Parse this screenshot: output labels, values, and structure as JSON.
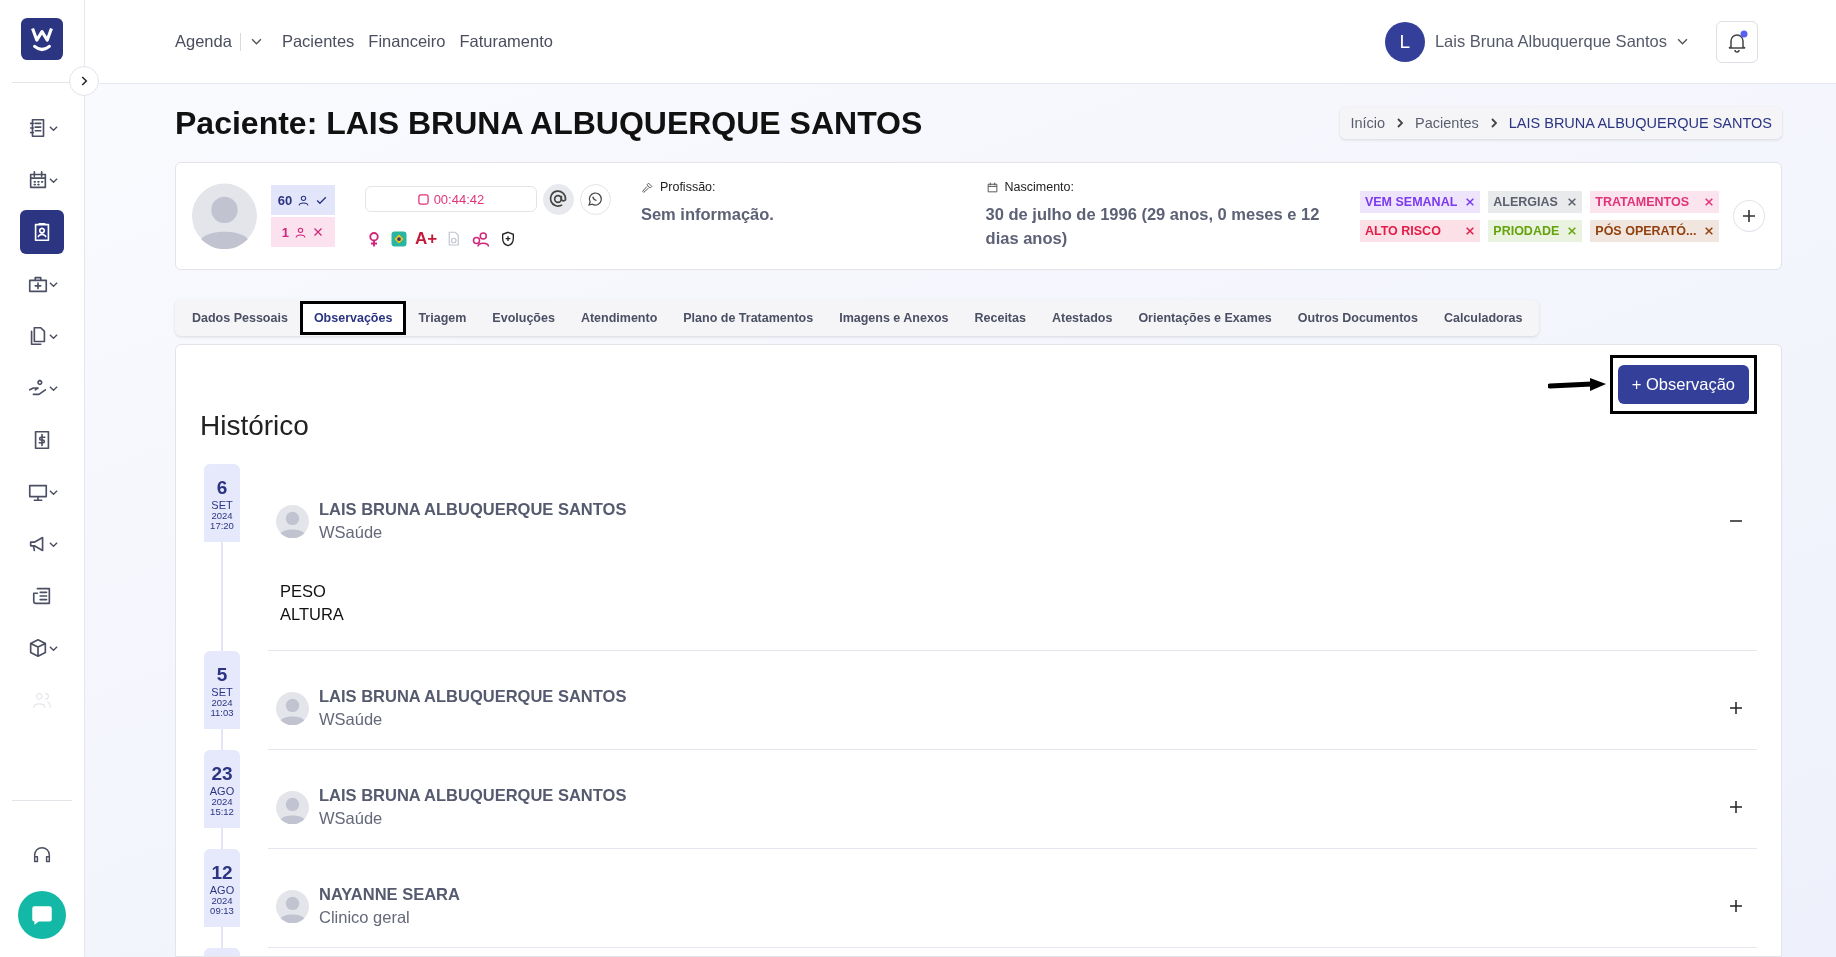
{
  "sidebar": {
    "items": [
      {
        "kind": "notebook",
        "dropdown": true,
        "selected": false,
        "disabled": false
      },
      {
        "kind": "calendar",
        "dropdown": true,
        "selected": false,
        "disabled": false
      },
      {
        "kind": "patient",
        "dropdown": false,
        "selected": true,
        "disabled": false
      },
      {
        "kind": "medkit",
        "dropdown": true,
        "selected": false,
        "disabled": false
      },
      {
        "kind": "documents",
        "dropdown": true,
        "selected": false,
        "disabled": false
      },
      {
        "kind": "hand",
        "dropdown": true,
        "selected": false,
        "disabled": false
      },
      {
        "kind": "receipt",
        "dropdown": false,
        "selected": false,
        "disabled": false
      },
      {
        "kind": "monitor",
        "dropdown": true,
        "selected": false,
        "disabled": false
      },
      {
        "kind": "megaphone",
        "dropdown": true,
        "selected": false,
        "disabled": false
      },
      {
        "kind": "newspaper",
        "dropdown": false,
        "selected": false,
        "disabled": false
      },
      {
        "kind": "box",
        "dropdown": true,
        "selected": false,
        "disabled": false
      },
      {
        "kind": "users",
        "dropdown": false,
        "selected": false,
        "disabled": true
      }
    ],
    "bottom": [
      {
        "kind": "headset",
        "dropdown": false,
        "selected": false,
        "disabled": false
      }
    ]
  },
  "topnav": [
    {
      "label": "Agenda",
      "dropdown": true
    },
    {
      "label": "Pacientes",
      "dropdown": false
    },
    {
      "label": "Financeiro",
      "dropdown": false
    },
    {
      "label": "Faturamento",
      "dropdown": false
    }
  ],
  "user": {
    "initial": "L",
    "name": "Lais Bruna Albuquerque Santos",
    "has_notification": true
  },
  "page_title": "Paciente: LAIS BRUNA ALBUQUERQUE SANTOS",
  "breadcrumb": [
    "Início",
    "Pacientes",
    "LAIS BRUNA ALBUQUERQUE SANTOS"
  ],
  "patient": {
    "attended": "60",
    "missed": "1",
    "timer": "00:44:42",
    "blood_type": "A+",
    "profession_label": "Profissão:",
    "profession": "Sem informação.",
    "birth_label": "Nascimento:",
    "birth": "30 de julho de 1996 (29 anos, 0 meses e 12 dias anos)",
    "tags": [
      {
        "label": "VEM SEMANAL",
        "color": "#7c3aed"
      },
      {
        "label": "ALERGIAS",
        "color": "#5b5f6e"
      },
      {
        "label": "TRATAMENTOS",
        "color": "#e0337a"
      },
      {
        "label": "ALTO RISCO",
        "color": "#e11d48"
      },
      {
        "label": "PRIODADE",
        "color": "#65a30d"
      },
      {
        "label": "PÓS OPERATÓ...",
        "color": "#92400e"
      }
    ]
  },
  "tabs": [
    {
      "label": "Dados Pessoais",
      "selected": false,
      "highlighted": false
    },
    {
      "label": "Observações",
      "selected": true,
      "highlighted": true
    },
    {
      "label": "Triagem",
      "selected": false,
      "highlighted": false
    },
    {
      "label": "Evoluções",
      "selected": false,
      "highlighted": false
    },
    {
      "label": "Atendimento",
      "selected": false,
      "highlighted": false
    },
    {
      "label": "Plano de Tratamentos",
      "selected": false,
      "highlighted": false
    },
    {
      "label": "Imagens e Anexos",
      "selected": false,
      "highlighted": false
    },
    {
      "label": "Receitas",
      "selected": false,
      "highlighted": false
    },
    {
      "label": "Atestados",
      "selected": false,
      "highlighted": false
    },
    {
      "label": "Orientações e Exames",
      "selected": false,
      "highlighted": false
    },
    {
      "label": "Outros Documentos",
      "selected": false,
      "highlighted": false
    },
    {
      "label": "Calculadoras",
      "selected": false,
      "highlighted": false
    }
  ],
  "add_button": {
    "label": "+ Observação",
    "highlighted": true
  },
  "history_title": "Histórico",
  "history": [
    {
      "day": "6",
      "month": "SET",
      "year": "2024",
      "time": "17:20",
      "author": "LAIS BRUNA ALBUQUERQUE SANTOS",
      "role": "WSaúde",
      "expanded": true,
      "body": [
        "PESO",
        "ALTURA"
      ]
    },
    {
      "day": "5",
      "month": "SET",
      "year": "2024",
      "time": "11:03",
      "author": "LAIS BRUNA ALBUQUERQUE SANTOS",
      "role": "WSaúde",
      "expanded": false
    },
    {
      "day": "23",
      "month": "AGO",
      "year": "2024",
      "time": "15:12",
      "author": "LAIS BRUNA ALBUQUERQUE SANTOS",
      "role": "WSaúde",
      "expanded": false
    },
    {
      "day": "12",
      "month": "AGO",
      "year": "2024",
      "time": "09:13",
      "author": "NAYANNE SEARA",
      "role": "Clinico geral",
      "expanded": false
    }
  ]
}
